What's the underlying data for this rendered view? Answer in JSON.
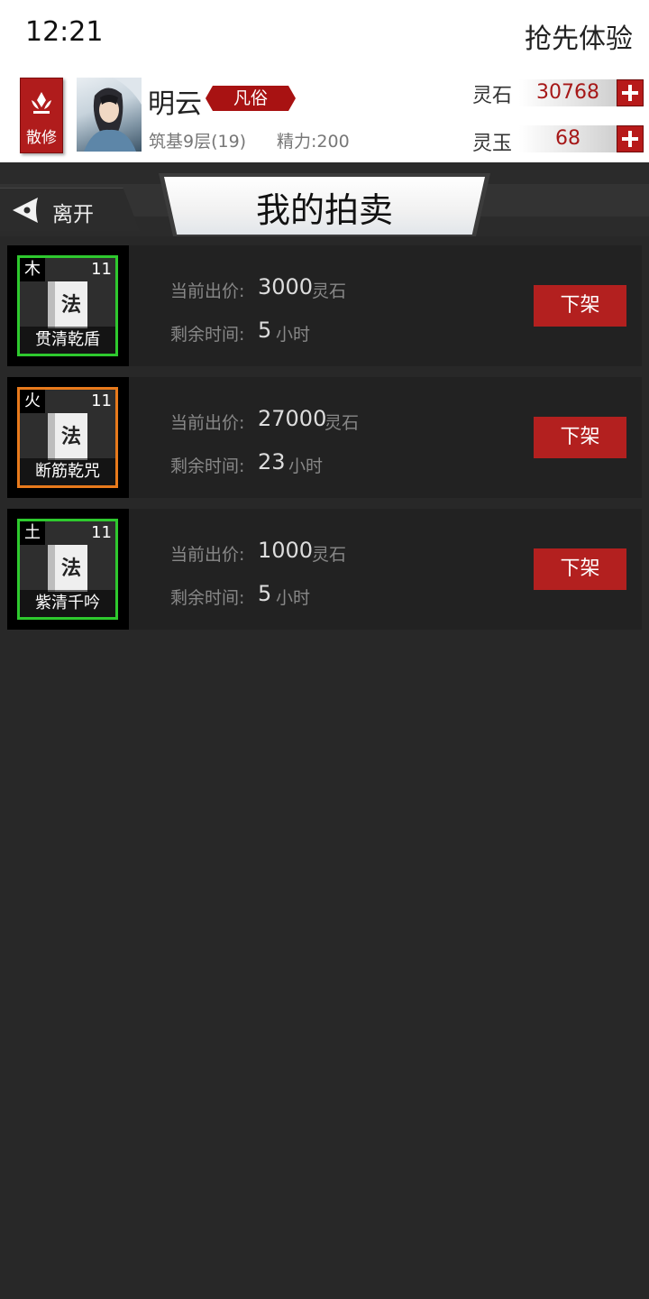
{
  "status_bar": {
    "time": "12:21",
    "early_access": "抢先体验"
  },
  "player": {
    "sect": "散修",
    "name": "明云",
    "rank": "凡俗",
    "realm": "筑基9层(19)",
    "energy": "精力:200"
  },
  "currency": {
    "spirit_stone_label": "灵石",
    "spirit_stone_value": "30768",
    "spirit_jade_label": "灵玉",
    "spirit_jade_value": "68"
  },
  "nav": {
    "leave_label": "离开",
    "title": "我的拍卖"
  },
  "auctions": [
    {
      "element": "木",
      "level": "11",
      "icon_char": "法",
      "name": "贯清乾盾",
      "bid_label": "当前出价:",
      "bid": "3000",
      "bid_unit": "灵石",
      "time_label": "剩余时间:",
      "time": "5",
      "time_unit": "小时",
      "action": "下架",
      "border_color": "#2ec92e"
    },
    {
      "element": "火",
      "level": "11",
      "icon_char": "法",
      "name": "断筋乾咒",
      "bid_label": "当前出价:",
      "bid": "27000",
      "bid_unit": "灵石",
      "time_label": "剩余时间:",
      "time": "23",
      "time_unit": "小时",
      "action": "下架",
      "border_color": "#e87a1c"
    },
    {
      "element": "土",
      "level": "11",
      "icon_char": "法",
      "name": "紫清千吟",
      "bid_label": "当前出价:",
      "bid": "1000",
      "bid_unit": "灵石",
      "time_label": "剩余时间:",
      "time": "5",
      "time_unit": "小时",
      "action": "下架",
      "border_color": "#2ec92e"
    }
  ]
}
